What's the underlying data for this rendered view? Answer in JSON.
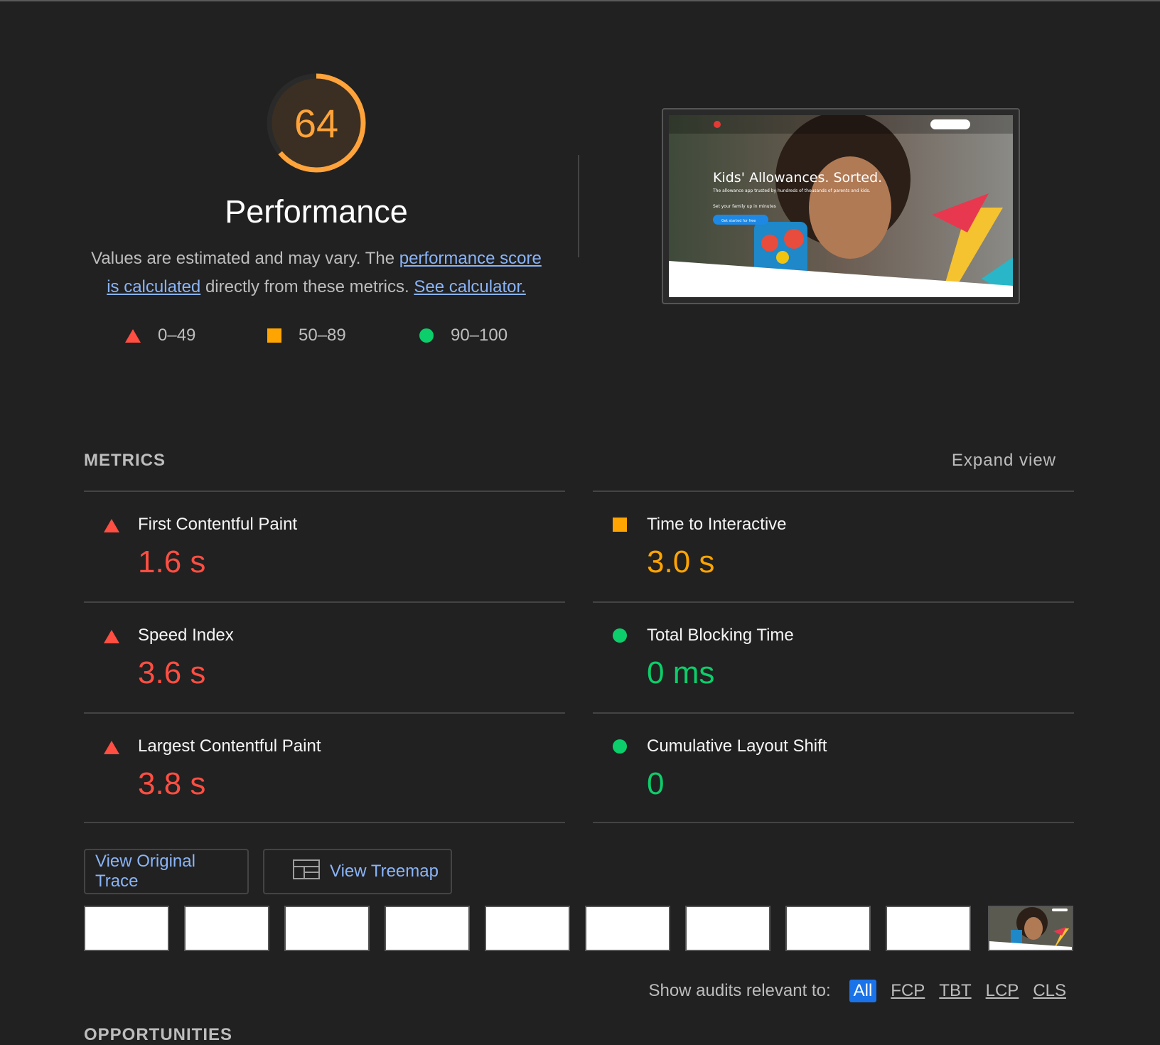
{
  "score": {
    "value": "64",
    "fraction": 0.64,
    "color": "#ffa33a",
    "title": "Performance"
  },
  "description": {
    "text1": "Values are estimated and may vary. The ",
    "link1": "performance score is calculated",
    "text2": " directly from these metrics. ",
    "link2": "See calculator."
  },
  "legend": {
    "fail": {
      "icon": "triangle-icon",
      "range": "0–49",
      "color": "#ff4e42"
    },
    "average": {
      "icon": "square-icon",
      "range": "50–89",
      "color": "#ffa400"
    },
    "pass": {
      "icon": "circle-icon",
      "range": "90–100",
      "color": "#0cce6b"
    }
  },
  "screenshot": {
    "headline": "Kids' Allowances. Sorted.",
    "subline": "The allowance app trusted by hundreds of thousands of parents and kids.",
    "tagline": "Set your family up in minutes",
    "cta": "Get started for free"
  },
  "metrics": {
    "header": "METRICS",
    "expand": "Expand view",
    "left": [
      {
        "title": "First Contentful Paint",
        "value": "1.6 s",
        "rating": "fail"
      },
      {
        "title": "Speed Index",
        "value": "3.6 s",
        "rating": "fail"
      },
      {
        "title": "Largest Contentful Paint",
        "value": "3.8 s",
        "rating": "fail"
      }
    ],
    "right": [
      {
        "title": "Time to Interactive",
        "value": "3.0 s",
        "rating": "average"
      },
      {
        "title": "Total Blocking Time",
        "value": "0 ms",
        "rating": "pass"
      },
      {
        "title": "Cumulative Layout Shift",
        "value": "0",
        "rating": "pass"
      }
    ]
  },
  "buttons": {
    "trace": "View Original Trace",
    "treemap": "View Treemap"
  },
  "filter": {
    "label": "Show audits relevant to:",
    "chips": [
      "All",
      "FCP",
      "TBT",
      "LCP",
      "CLS"
    ]
  },
  "opportunities": "OPPORTUNITIES"
}
